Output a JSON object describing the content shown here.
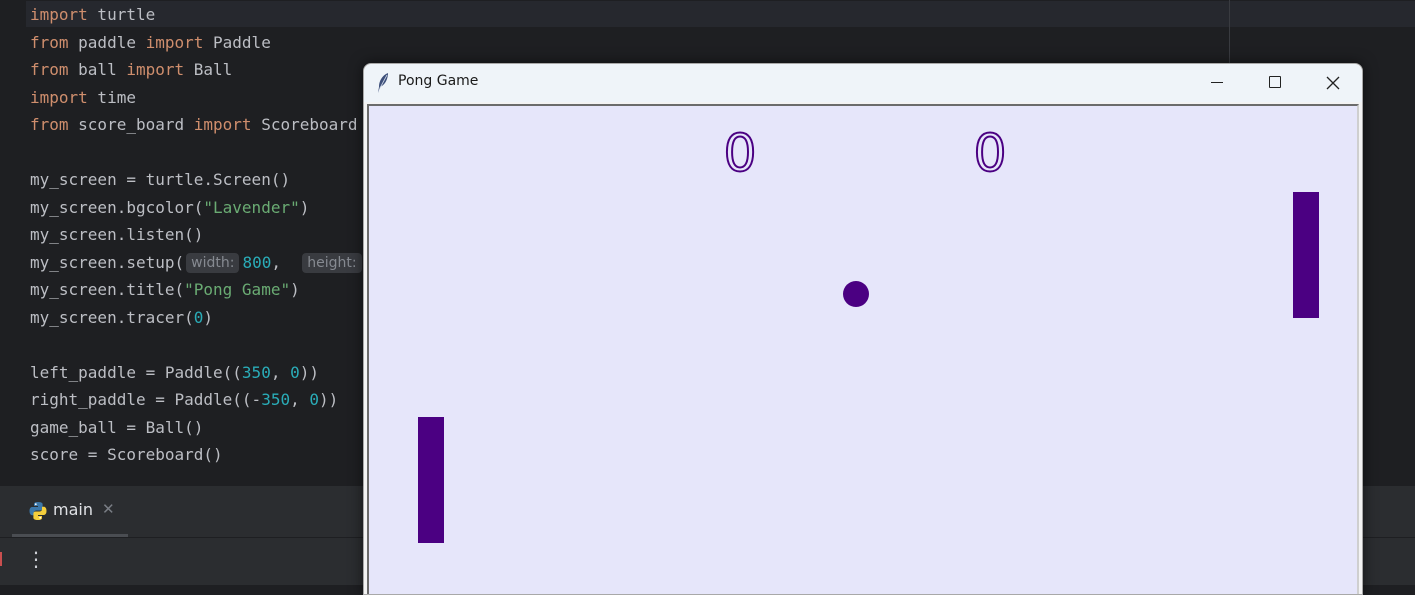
{
  "editor": {
    "lines": [
      [
        {
          "t": "import",
          "c": "kw"
        },
        {
          "t": " turtle"
        }
      ],
      [
        {
          "t": "from",
          "c": "kw"
        },
        {
          "t": " paddle "
        },
        {
          "t": "import",
          "c": "kw"
        },
        {
          "t": " Paddle"
        }
      ],
      [
        {
          "t": "from",
          "c": "kw"
        },
        {
          "t": " ball "
        },
        {
          "t": "import",
          "c": "kw"
        },
        {
          "t": " Ball"
        }
      ],
      [
        {
          "t": "import",
          "c": "kw"
        },
        {
          "t": " time"
        }
      ],
      [
        {
          "t": "from",
          "c": "kw"
        },
        {
          "t": " score_board "
        },
        {
          "t": "import",
          "c": "kw"
        },
        {
          "t": " Scoreboard"
        }
      ],
      [],
      [
        {
          "t": "my_screen = turtle.Screen()"
        }
      ],
      [
        {
          "t": "my_screen.bgcolor("
        },
        {
          "t": "\"Lavender\"",
          "c": "str"
        },
        {
          "t": ")"
        }
      ],
      [
        {
          "t": "my_screen.listen()"
        }
      ],
      [
        {
          "t": "my_screen.setup("
        },
        {
          "t": "width:",
          "c": "hint"
        },
        {
          "t": "800",
          "c": "num"
        },
        {
          "t": ",  "
        },
        {
          "t": "height:",
          "c": "hint"
        }
      ],
      [
        {
          "t": "my_screen.title("
        },
        {
          "t": "\"Pong Game\"",
          "c": "str"
        },
        {
          "t": ")"
        }
      ],
      [
        {
          "t": "my_screen.tracer("
        },
        {
          "t": "0",
          "c": "num"
        },
        {
          "t": ")"
        }
      ],
      [],
      [
        {
          "t": "left_paddle = Paddle(("
        },
        {
          "t": "350",
          "c": "num"
        },
        {
          "t": ", "
        },
        {
          "t": "0",
          "c": "num"
        },
        {
          "t": "))"
        }
      ],
      [
        {
          "t": "right_paddle = Paddle((-"
        },
        {
          "t": "350",
          "c": "num"
        },
        {
          "t": ", "
        },
        {
          "t": "0",
          "c": "num"
        },
        {
          "t": "))"
        }
      ],
      [
        {
          "t": "game_ball = Ball()"
        }
      ],
      [
        {
          "t": "score = Scoreboard()"
        }
      ]
    ]
  },
  "bottom_panel": {
    "run_tab": {
      "label": "main",
      "close": "✕",
      "icon": "python-icon"
    },
    "more_button": "⋮"
  },
  "pong_window": {
    "title": "Pong Game",
    "icon": "feather-icon",
    "canvas_background": "#e6e6fa",
    "game_color": "#4b0082",
    "left_score": "0",
    "right_score": "0"
  }
}
